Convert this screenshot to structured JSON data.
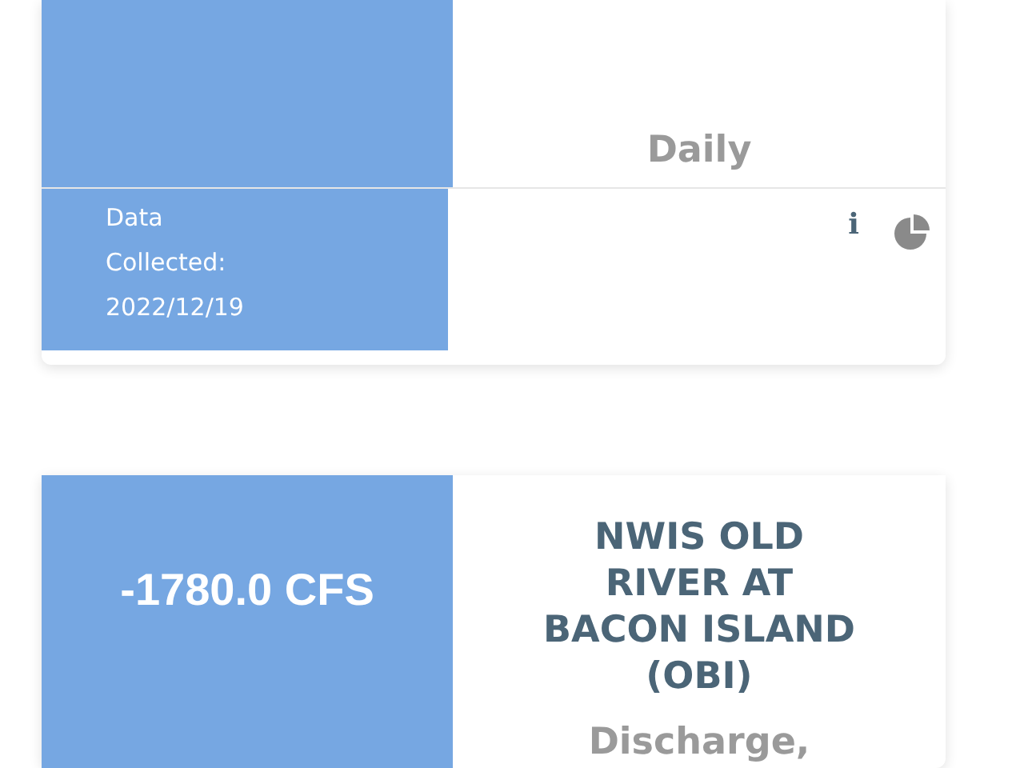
{
  "cards": [
    {
      "subtitle": "Daily",
      "footer": {
        "label": "Data Collected: 2022/12/19",
        "info": "i"
      }
    },
    {
      "value": "-1780.0 CFS",
      "title": "NWIS OLD RIVER AT BACON ISLAND (OBI)",
      "subtitle": "Discharge,"
    }
  ]
}
